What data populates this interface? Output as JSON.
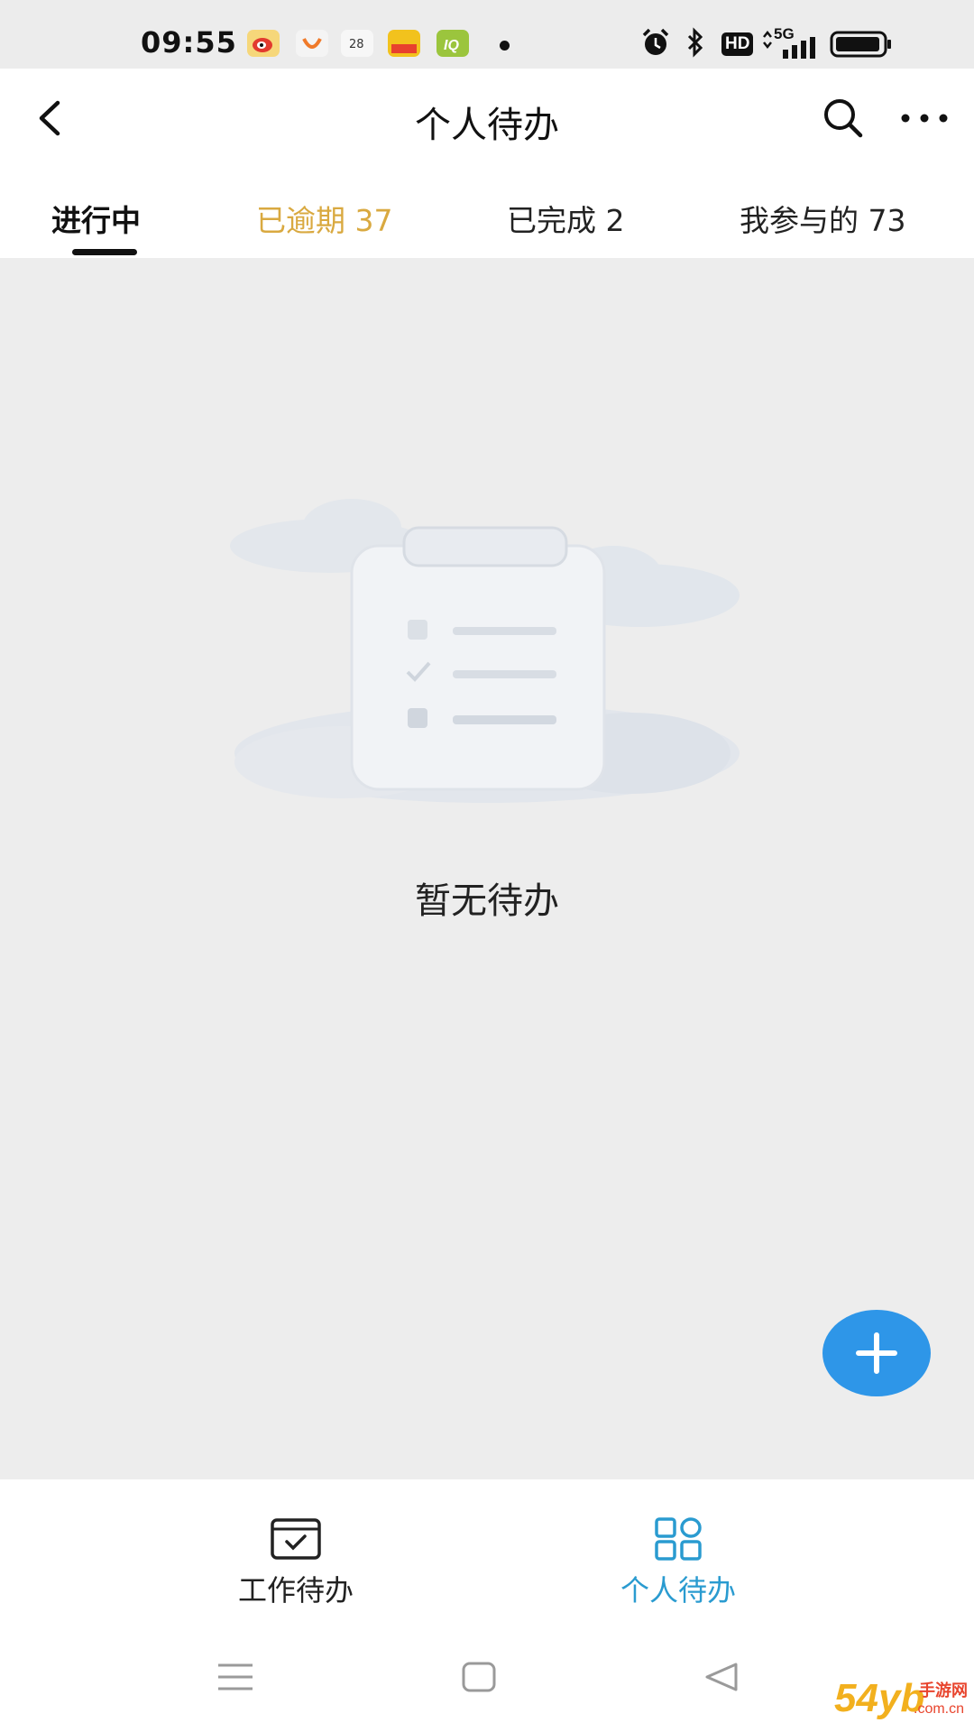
{
  "status_bar": {
    "time": "09:55",
    "network": "5G",
    "hd": "HD",
    "calendar_day": "28",
    "icons": [
      "weibo-icon",
      "didi-icon",
      "calendar-icon",
      "game-app-icon",
      "iq-app-icon",
      "notification-dot-icon",
      "alarm-icon",
      "bluetooth-icon",
      "hd-icon",
      "signal-5g-icon",
      "battery-icon"
    ]
  },
  "header": {
    "title": "个人待办",
    "back_icon": "chevron-left-icon",
    "search_icon": "search-icon",
    "more_icon": "more-horizontal-icon"
  },
  "tabs": [
    {
      "label": "进行中",
      "state": "active"
    },
    {
      "label": "已逾期 37",
      "state": "warning"
    },
    {
      "label": "已完成 2",
      "state": "normal"
    },
    {
      "label": "我参与的 73",
      "state": "normal"
    }
  ],
  "empty_state": {
    "text": "暂无待办",
    "illustration": "clipboard-checklist-illustration"
  },
  "fab": {
    "icon": "plus-icon"
  },
  "bottom_nav": [
    {
      "label": "工作待办",
      "icon": "inbox-check-icon",
      "active": false
    },
    {
      "label": "个人待办",
      "icon": "grid-icon",
      "active": true
    }
  ],
  "system_nav": [
    "menu-icon",
    "home-icon",
    "back-triangle-icon"
  ],
  "watermark": {
    "text": "54yb",
    "sub": "手游网",
    "domain": ".com.cn"
  },
  "colors": {
    "overdue_tab": "#d9a940",
    "accent": "#2e96e8",
    "active_nav": "#2a9bd0",
    "background": "#ededed"
  }
}
